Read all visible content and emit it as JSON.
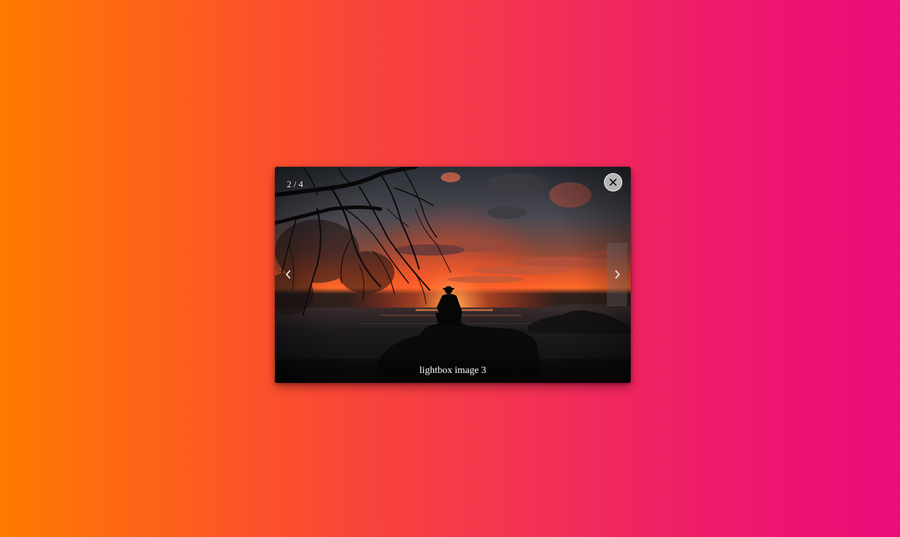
{
  "lightbox": {
    "counter": "2 / 4",
    "caption": "lightbox image 3",
    "close_icon": "close-icon",
    "prev_icon": "chevron-left-icon",
    "next_icon": "chevron-right-icon"
  },
  "colors": {
    "background_left": "#ff7a00",
    "background_right": "#ec0b7a"
  }
}
